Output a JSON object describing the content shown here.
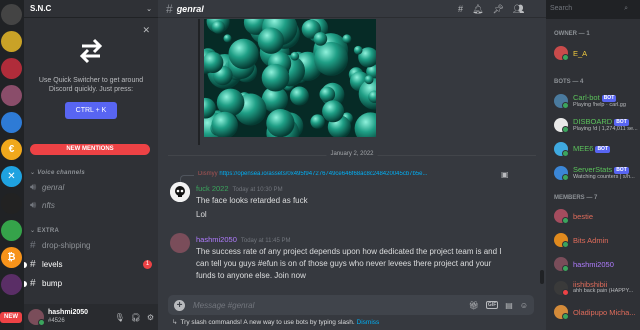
{
  "server": {
    "name": "S.N.C"
  },
  "rail": {
    "servers": [
      {
        "color": "#444",
        "glyph": "",
        "badge": ""
      },
      {
        "color": "#c9a227",
        "glyph": "",
        "badge": "13"
      },
      {
        "color": "#b02c3a",
        "glyph": "",
        "badge": "2"
      },
      {
        "color": "#8a4d6a",
        "glyph": "",
        "badge": "2"
      },
      {
        "color": "#2e7bd6",
        "glyph": "",
        "badge": ""
      },
      {
        "color": "#f0a81c",
        "glyph": "€",
        "badge": ""
      },
      {
        "color": "#1fa2e0",
        "glyph": "✕",
        "badge": ""
      },
      {
        "color": "#222",
        "glyph": "",
        "badge": "12"
      },
      {
        "color": "#35a34a",
        "glyph": "",
        "badge": ""
      },
      {
        "color": "#f7931a",
        "glyph": "₿",
        "badge": ""
      },
      {
        "color": "#5a2e66",
        "glyph": "",
        "badge": "24"
      }
    ],
    "new_label": "NEW"
  },
  "quick_switcher": {
    "text": "Use Quick Switcher to get around Discord quickly. Just press:",
    "shortcut": "CTRL + K"
  },
  "new_mentions": "NEW MENTIONS",
  "categories": {
    "voice": "Voice channels",
    "extra": "EXTRA"
  },
  "voice_channels": [
    "genral",
    "nfts"
  ],
  "text_channels": [
    {
      "name": "drop-shipping",
      "unread": false,
      "mentions": ""
    },
    {
      "name": "levels",
      "unread": true,
      "mentions": "1"
    },
    {
      "name": "bump",
      "unread": true,
      "mentions": ""
    }
  ],
  "user": {
    "name": "hashmi2050",
    "tag": "#4526"
  },
  "channel": {
    "name": "genral"
  },
  "search": {
    "placeholder": "Search"
  },
  "date_divider": "January 2, 2022",
  "reply": {
    "name": "Dismyy",
    "link": "https://opensea.io/assets/0x495f947276749ce646f68ac8c248420045cb7b5e..."
  },
  "messages": [
    {
      "author": "fuck 2022",
      "author_color": "#3ba55d",
      "time": "Today at 10:30 PM",
      "lines": [
        "The face looks retarded as fuck",
        "Lol"
      ]
    },
    {
      "author": "hashmi2050",
      "author_color": "#b07cff",
      "time": "Today at 11:45 PM",
      "lines": [
        "The success rate of any project depends upon how dedicated the project team is and I",
        "can tell you guys #efun is on of those guys who never levees there project and your",
        "funds to anyone else. Join now"
      ]
    }
  ],
  "composer": {
    "placeholder": "Message #genral",
    "gif": "GIF"
  },
  "slash_tip": {
    "text": "Try slash commands! A new way to use bots by typing slash.",
    "dismiss": "Dismiss"
  },
  "members": {
    "owner_header": "OWNER — 1",
    "bots_header": "BOTS — 4",
    "members_header": "MEMBERS — 7",
    "owner": [
      {
        "name": "E_A",
        "color": "#f0c93e",
        "avatar": "#c94b4b",
        "status": "",
        "bot": ""
      }
    ],
    "bots": [
      {
        "name": "Carl-bot",
        "color": "#5bc15b",
        "avatar": "#4a7a9e",
        "status": "Playing !help · carl.gg",
        "bot": "BOT"
      },
      {
        "name": "DISBOARD",
        "color": "#5bc15b",
        "avatar": "#e8e8e8",
        "status": "Playing !d | 1,274,011 se...",
        "bot": "BOT"
      },
      {
        "name": "MEE6",
        "color": "#5bc15b",
        "avatar": "#3fa9e0",
        "status": "",
        "bot": "BOT"
      },
      {
        "name": "ServerStats",
        "color": "#5bc15b",
        "avatar": "#3b86d6",
        "status": "Watching counters | s/h...",
        "bot": "BOT"
      }
    ],
    "members": [
      {
        "name": "bestie",
        "color": "#e06c5b",
        "avatar": "#a44c5e",
        "status": "",
        "dnd": false
      },
      {
        "name": "Bits Admin",
        "color": "#e06c5b",
        "avatar": "#e08a1e",
        "status": "",
        "dnd": false
      },
      {
        "name": "hashmi2050",
        "color": "#b07cff",
        "avatar": "#7a4d5a",
        "status": "",
        "dnd": false
      },
      {
        "name": "iishibshibii",
        "color": "#e06c5b",
        "avatar": "#3a3a3a",
        "status": "ahh back pain (HAPPY...",
        "dnd": true
      },
      {
        "name": "Oladipupo Micha...",
        "color": "#e06c5b",
        "avatar": "#d48b3a",
        "status": "",
        "dnd": false
      }
    ]
  }
}
